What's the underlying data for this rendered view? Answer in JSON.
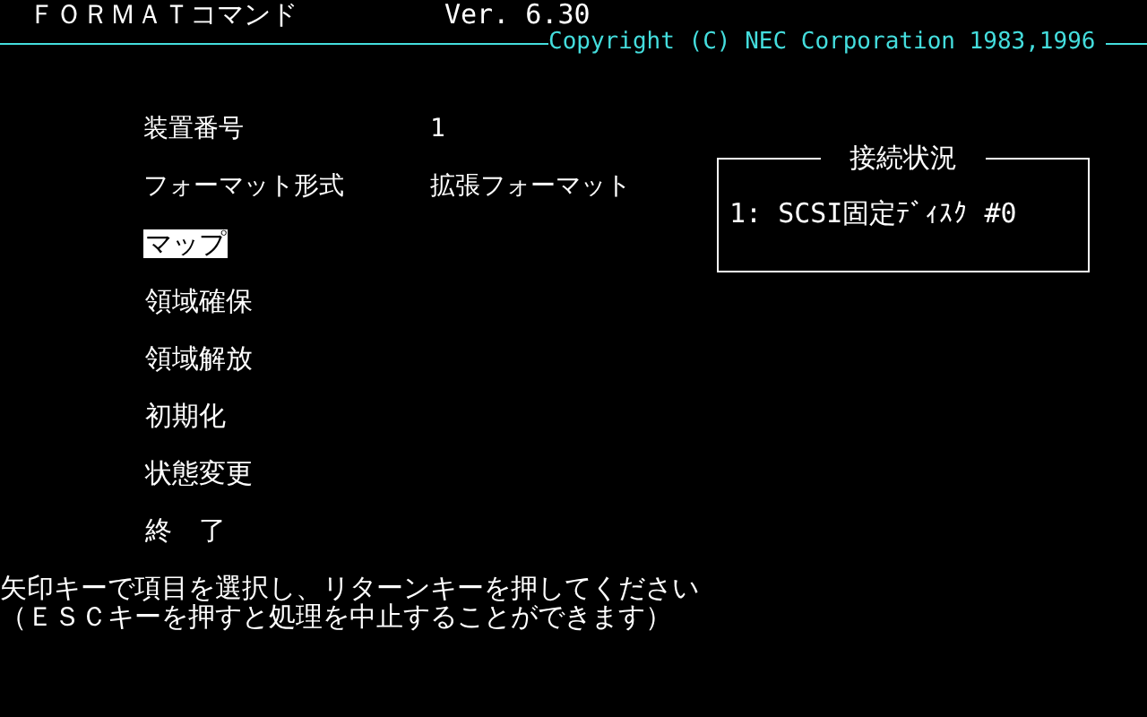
{
  "header": {
    "title": "ＦＯＲＭＡＴコマンド",
    "version": "Ver. 6.30",
    "copyright": "Copyright (C) NEC Corporation 1983,1996"
  },
  "info": [
    {
      "label": "装置番号",
      "value": "1"
    },
    {
      "label": "フォーマット形式",
      "value": "拡張フォーマット"
    }
  ],
  "menu": [
    {
      "label": "マップ",
      "selected": true
    },
    {
      "label": "領域確保",
      "selected": false
    },
    {
      "label": "領域解放",
      "selected": false
    },
    {
      "label": "初期化",
      "selected": false
    },
    {
      "label": "状態変更",
      "selected": false
    },
    {
      "label": "終　了",
      "selected": false
    }
  ],
  "connection_panel": {
    "title": "接続状況",
    "devices": [
      "1: SCSI固定ﾃﾞｨｽｸ #0"
    ]
  },
  "footer": [
    "矢印キーで項目を選択し、リターンキーを押してください",
    "（ＥＳＣキーを押すと処理を中止することができます）"
  ]
}
